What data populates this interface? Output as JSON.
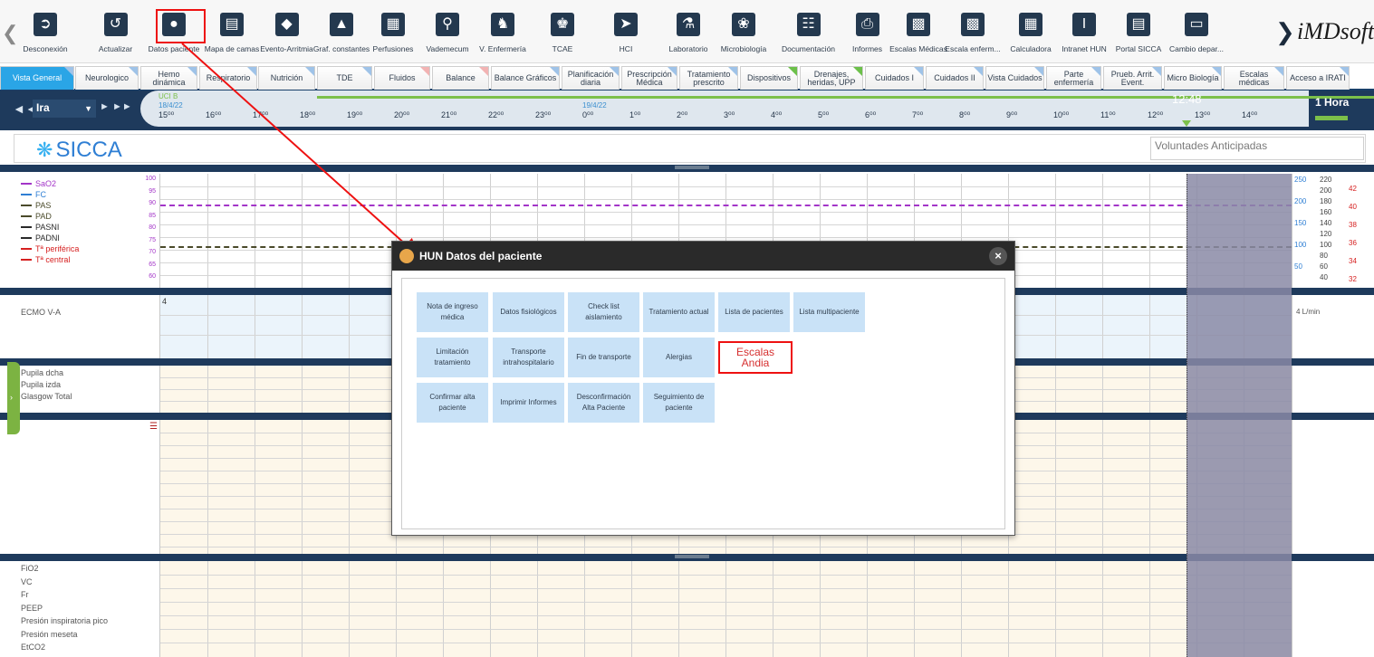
{
  "toolbar": {
    "brand": "iMDsoft",
    "buttons": [
      {
        "label": "Desconexión",
        "icon": "logout-icon"
      },
      {
        "label": "Actualizar",
        "icon": "refresh-icon"
      },
      {
        "label": "Datos paciente",
        "icon": "patient-icon"
      },
      {
        "label": "Mapa de camas",
        "icon": "bed-icon"
      },
      {
        "label": "Evento-Arritmia",
        "icon": "arrhythmia-icon"
      },
      {
        "label": "Graf. constantes",
        "icon": "chart-icon"
      },
      {
        "label": "Perfusiones",
        "icon": "infusion-icon"
      },
      {
        "label": "Vademecum",
        "icon": "drug-search-icon"
      },
      {
        "label": "V. Enfermería",
        "icon": "nurse-icon"
      },
      {
        "label": "TCAE",
        "icon": "staff-icon"
      },
      {
        "label": "HCI",
        "icon": "folder-icon"
      },
      {
        "label": "Laboratorio",
        "icon": "flask-icon"
      },
      {
        "label": "Microbiología",
        "icon": "microbe-icon"
      },
      {
        "label": "Documentación",
        "icon": "document-icon"
      },
      {
        "label": "Informes",
        "icon": "print-icon"
      },
      {
        "label": "Escalas Médicas",
        "icon": "scale-chart-icon"
      },
      {
        "label": "Escala enferm...",
        "icon": "scale-chart-icon"
      },
      {
        "label": "Calculadora",
        "icon": "calculator-icon"
      },
      {
        "label": "Intranet HUN",
        "icon": "intranet-icon"
      },
      {
        "label": "Portal SICCA",
        "icon": "portal-icon"
      },
      {
        "label": "Cambio depar...",
        "icon": "department-icon"
      }
    ]
  },
  "tabs": [
    {
      "label": "Vista General",
      "active": true,
      "corner": "blue"
    },
    {
      "label": "Neurologico",
      "corner": "blue"
    },
    {
      "label": "Hemo dinámica",
      "corner": "blue"
    },
    {
      "label": "Respiratorio",
      "corner": "blue"
    },
    {
      "label": "Nutrición",
      "corner": "blue"
    },
    {
      "label": "TDE",
      "corner": "blue"
    },
    {
      "label": "Fluidos",
      "corner": "red"
    },
    {
      "label": "Balance",
      "corner": "red"
    },
    {
      "label": "Balance Gráficos",
      "corner": "blue"
    },
    {
      "label": "Planificación diaria",
      "corner": "blue"
    },
    {
      "label": "Prescripción Médica",
      "corner": "blue"
    },
    {
      "label": "Tratamiento prescrito",
      "corner": "blue"
    },
    {
      "label": "Dispositivos",
      "corner": "green"
    },
    {
      "label": "Drenajes, heridas, UPP",
      "corner": "green"
    },
    {
      "label": "Cuidados I",
      "corner": "blue"
    },
    {
      "label": "Cuidados II",
      "corner": "blue"
    },
    {
      "label": "Vista Cuidados",
      "corner": "blue"
    },
    {
      "label": "Parte enfermería",
      "corner": "blue"
    },
    {
      "label": "Prueb. Arrit. Event.",
      "corner": "blue"
    },
    {
      "label": "Micro Biología",
      "corner": "blue"
    },
    {
      "label": "Escalas médicas",
      "corner": "blue"
    },
    {
      "label": "Acceso a IRATI",
      "corner": "blue"
    }
  ],
  "timeline": {
    "nav_back": "◄◄ ◄",
    "select_value": "Ira",
    "nav_forward": "► ►►",
    "unit": "UCI B",
    "date_start": "18/4/22",
    "date_next": "19/4/22",
    "hours": [
      "15⁰⁰",
      "16⁰⁰",
      "17⁰⁰",
      "18⁰⁰",
      "19⁰⁰",
      "20⁰⁰",
      "21⁰⁰",
      "22⁰⁰",
      "23⁰⁰",
      "0⁰⁰",
      "1⁰⁰",
      "2⁰⁰",
      "3⁰⁰",
      "4⁰⁰",
      "5⁰⁰",
      "6⁰⁰",
      "7⁰⁰",
      "8⁰⁰",
      "9⁰⁰",
      "10⁰⁰",
      "11⁰⁰",
      "12⁰⁰",
      "13⁰⁰",
      "14⁰⁰"
    ],
    "now": "12:48",
    "scale": "1 Hora"
  },
  "header": {
    "logo": "SICCA",
    "voluntades": "Voluntades Anticipadas"
  },
  "vitals": {
    "legend": [
      {
        "label": "SaO2",
        "color": "#a335c8"
      },
      {
        "label": "FC",
        "color": "#2f7fd4"
      },
      {
        "label": "PAS",
        "color": "#4a4a2a"
      },
      {
        "label": "PAD",
        "color": "#4a4a2a"
      },
      {
        "label": "PASNI",
        "color": "#2a2a2a"
      },
      {
        "label": "PADNI",
        "color": "#2a2a2a"
      },
      {
        "label": "Tª periférica",
        "color": "#d62020"
      },
      {
        "label": "Tª central",
        "color": "#d62020"
      }
    ],
    "left_scale": [
      "100",
      "95",
      "90",
      "85",
      "80",
      "75",
      "70",
      "65",
      "60"
    ],
    "right_scale_a": [
      "250",
      "200",
      "150",
      "100",
      "50"
    ],
    "right_scale_b": [
      "220",
      "200",
      "180",
      "160",
      "140",
      "120",
      "100",
      "80",
      "60",
      "40"
    ],
    "right_scale_c": [
      "42",
      "40",
      "38",
      "36",
      "34",
      "32"
    ]
  },
  "ecmo": {
    "label": "ECMO V-A",
    "value": "4",
    "right": "4 L/min"
  },
  "neuro": {
    "rows": [
      "Pupila dcha",
      "Pupila izda",
      "Glasgow Total"
    ]
  },
  "resp": {
    "rows": [
      "FiO2",
      "VC",
      "Fr",
      "PEEP",
      "Presión inspiratoria pico",
      "Presión meseta",
      "EtCO2"
    ]
  },
  "dialog": {
    "title": "HUN Datos del paciente",
    "close": "×",
    "buttons": [
      "Nota de ingreso médica",
      "Datos fisiológicos",
      "Check list aislamiento",
      "Tratamiento actual",
      "Lista de pacientes",
      "Lista multipaciente",
      "Limitación tratamiento",
      "Transporte intrahospitalario",
      "Fin de transporte",
      "Alergias",
      "Escalas Andia",
      "Confirmar alta paciente",
      "Imprimir Informes",
      "Desconfirmación Alta Paciente",
      "Seguimiento de paciente"
    ]
  }
}
